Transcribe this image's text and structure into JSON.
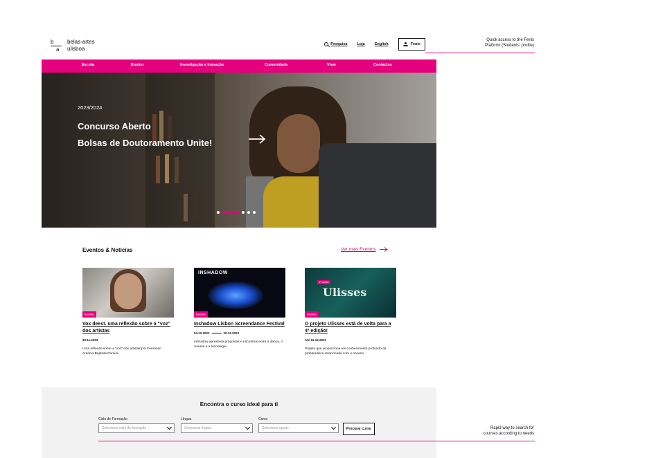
{
  "header": {
    "logo_letter_top": "b",
    "logo_letter_bottom": "a",
    "logo_line1": "belas-artes",
    "logo_line2": "ulisboa",
    "search_label": "Pesquisa",
    "shop_label": "Loja",
    "language_label": "English",
    "fenix_label": "Fenix"
  },
  "menu": {
    "items": [
      "Escola",
      "Ensino",
      "Investigação e Inovação",
      "Comunidade",
      "Viver",
      "Contactos"
    ]
  },
  "hero": {
    "year": "2023/2024",
    "title_line1": "Concurso Aberto",
    "title_line2": "Bolsas de Doutoramento Unite!",
    "carousel_active_index": 1,
    "carousel_count": 5
  },
  "news": {
    "heading": "Eventos & Notícias",
    "more_link": "Ver mais Eventos",
    "cards": [
      {
        "badge": "Evento",
        "title": "Vox deest. uma reflexão sobre a “voz” dos artistas",
        "date": "30.11.2023",
        "date_end": "",
        "description": "Uma reflexão sobre a “voz” dos artistas por Fernando António Baptista Pereira."
      },
      {
        "badge": "Evento",
        "image_text": "INSHADOW",
        "title": "Inshadow Lisbon Screendance Festival",
        "date": "04.12.2023",
        "date_end": "20.12.2023",
        "description": "Inshadow apresenta propostas e encontros entre a dança, o cinema e a tecnologia."
      },
      {
        "badge": "Evento",
        "image_text": "Ulisses",
        "image_edition": "4ª edição",
        "title": "O projeto Ulisses está de volta para a 4ª edição!",
        "date": "Até 15.12.2023",
        "date_end": "",
        "description": "Projeto que proporciona um conhecimento profundo da problemática relacionada com o oceano."
      }
    ]
  },
  "course_search": {
    "title": "Encontra o curso ideal para ti",
    "cycle_label": "Ciclo de Formação",
    "cycle_placeholder": "Selecionar ciclo de formação",
    "language_label": "Língua",
    "language_placeholder": "Selecionar língua",
    "course_label": "Curso",
    "course_placeholder": "Selecionar opção",
    "button_label": "Procurar curso"
  },
  "annotations": {
    "fenix_note_line1": "Quick access to the Fenix",
    "fenix_note_line2": "Platform (Students' profile)",
    "search_note_line1": "Rapid way to search for",
    "search_note_line2": "courses according to needs"
  },
  "colors": {
    "accent": "#e5007e",
    "course_bg": "#f2f2f2"
  }
}
